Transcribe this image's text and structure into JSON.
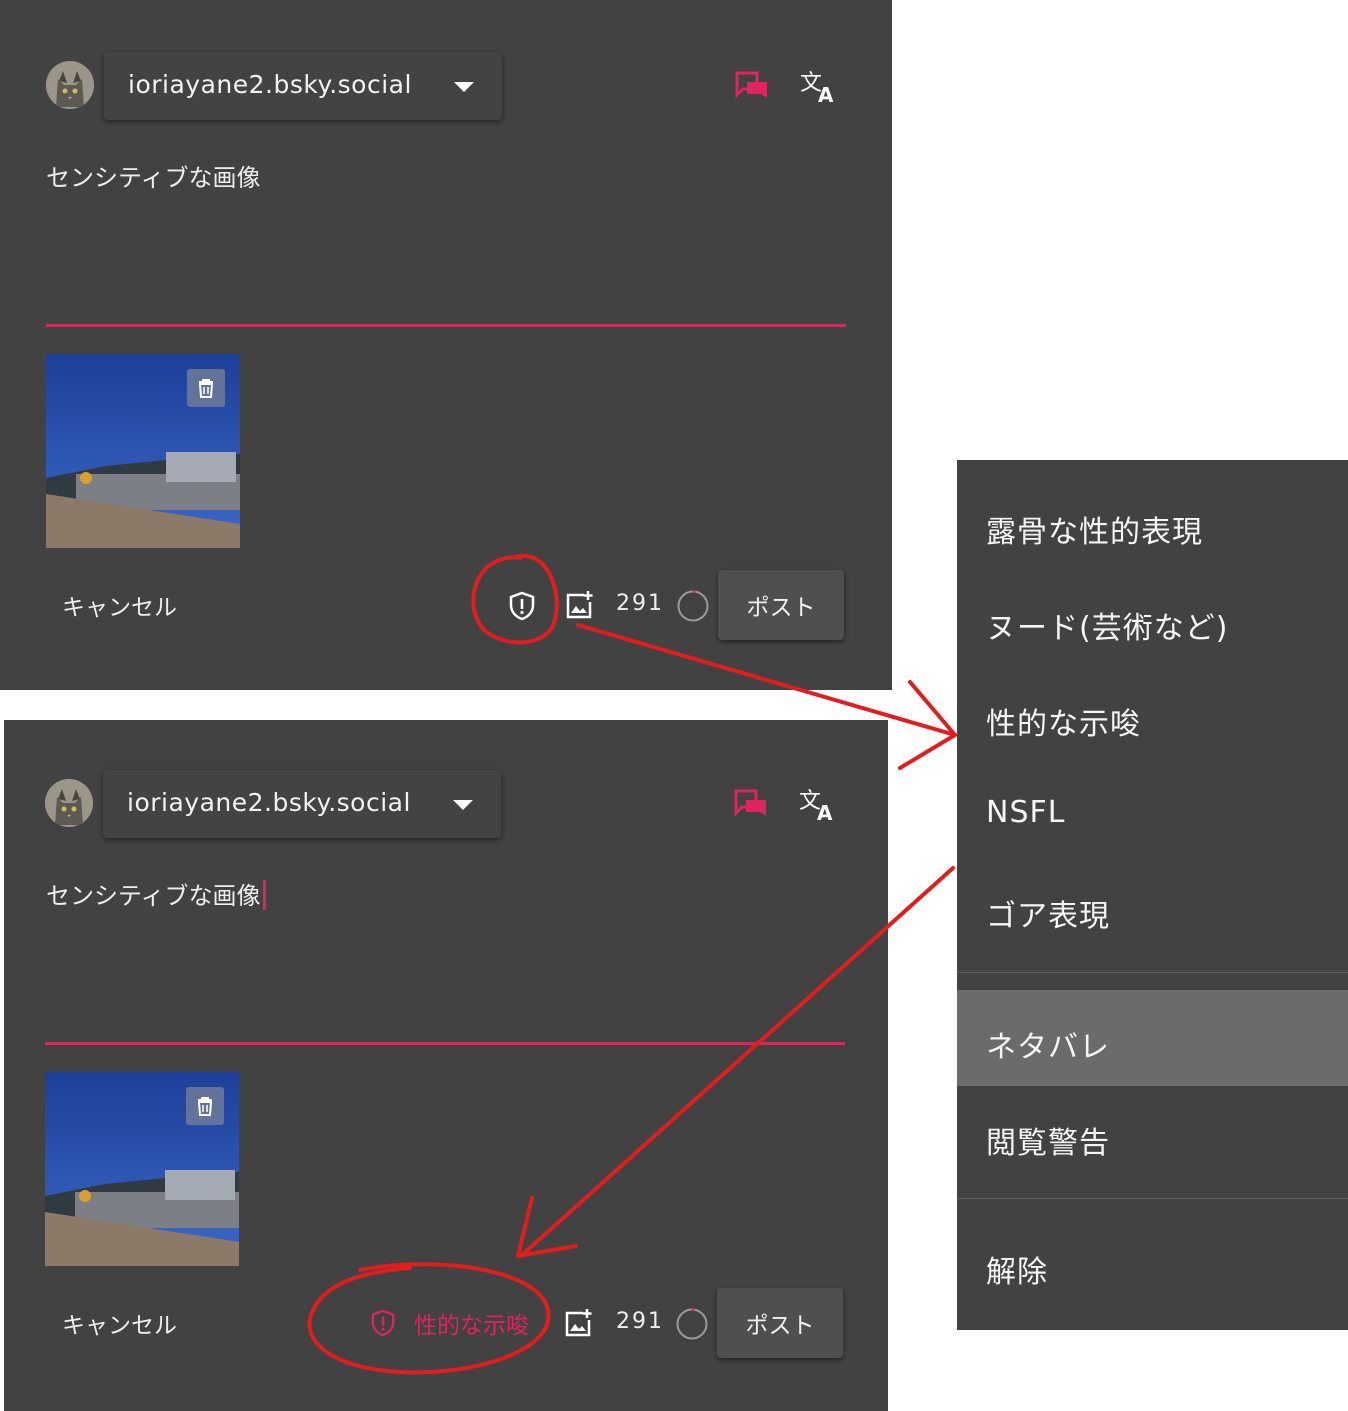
{
  "composer_top": {
    "account": "ioriayane2.bsky.social",
    "text": "センシティブな画像",
    "cancel_label": "キャンセル",
    "char_count": "291",
    "post_label": "ポスト",
    "label_applied": ""
  },
  "composer_bottom": {
    "account": "ioriayane2.bsky.social",
    "text": "センシティブな画像",
    "cancel_label": "キャンセル",
    "char_count": "291",
    "post_label": "ポスト",
    "label_applied": "性的な示唆"
  },
  "label_menu": {
    "items": [
      "露骨な性的表現",
      "ヌード(芸術など)",
      "性的な示唆",
      "NSFL",
      "ゴア表現",
      "ネタバレ",
      "閲覧警告",
      "解除"
    ],
    "highlighted_index": 5
  },
  "colors": {
    "panel_bg": "#424242",
    "accent": "#e0245e",
    "annotation": "#e11d1d"
  },
  "icons": [
    "chat-bubbles-icon",
    "translate-icon",
    "chevron-down-icon",
    "trash-icon",
    "shield-alert-icon",
    "add-image-icon",
    "progress-ring-icon"
  ]
}
